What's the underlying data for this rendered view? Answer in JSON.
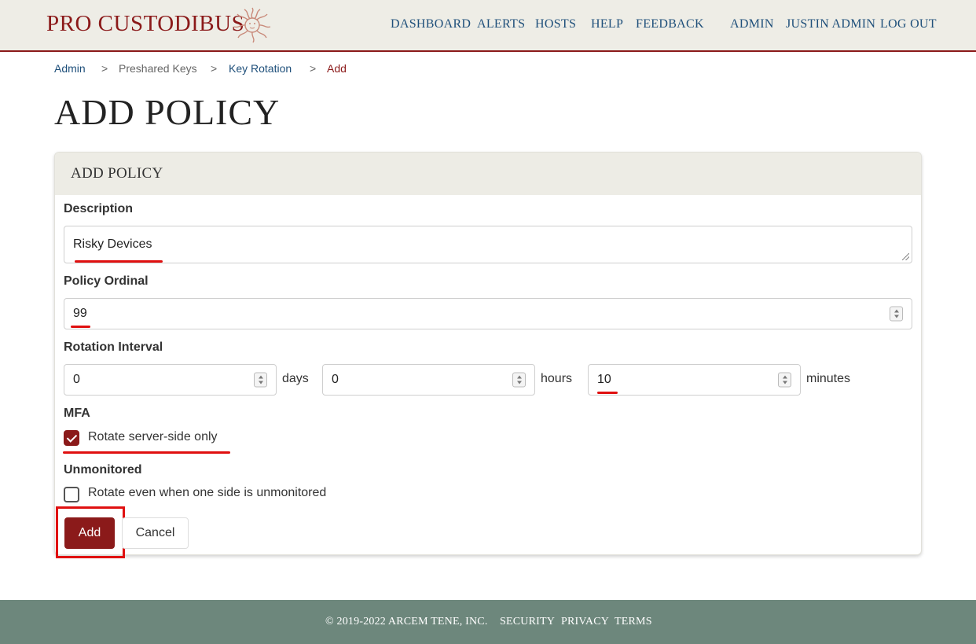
{
  "header": {
    "logo_text": "PRO CUSTODIBUS",
    "nav": {
      "dashboard": "DASHBOARD",
      "alerts": "ALERTS",
      "hosts": "HOSTS",
      "help": "HELP",
      "feedback": "FEEDBACK",
      "admin": "ADMIN",
      "user": "JUSTIN ADMIN",
      "logout": "LOG OUT"
    }
  },
  "breadcrumb": {
    "items": [
      "Admin",
      "Preshared Keys",
      "Key Rotation",
      "Add"
    ],
    "separator": ">"
  },
  "page_title": "ADD POLICY",
  "card": {
    "title": "ADD POLICY",
    "description": {
      "label": "Description",
      "value": "Risky Devices"
    },
    "ordinal": {
      "label": "Policy Ordinal",
      "value": "99"
    },
    "interval": {
      "label": "Rotation Interval",
      "days": {
        "value": "0",
        "unit": "days"
      },
      "hours": {
        "value": "0",
        "unit": "hours"
      },
      "minutes": {
        "value": "10",
        "unit": "minutes"
      }
    },
    "mfa": {
      "label": "MFA",
      "option": "Rotate server-side only",
      "checked": true
    },
    "unmonitored": {
      "label": "Unmonitored",
      "option": "Rotate even when one side is unmonitored",
      "checked": false
    },
    "add_label": "Add",
    "cancel_label": "Cancel"
  },
  "footer": {
    "copyright": "© 2019-2022 ARCEM TENE, INC.",
    "security": "SECURITY",
    "privacy": "PRIVACY",
    "terms": "TERMS"
  },
  "colors": {
    "brand": "#8b1a1a",
    "link": "#1e4f7a",
    "header_bg": "#eeede6",
    "footer_bg": "#6d877c",
    "highlight": "#e01010"
  },
  "icons": {
    "logo": "medusa-logo-icon"
  }
}
